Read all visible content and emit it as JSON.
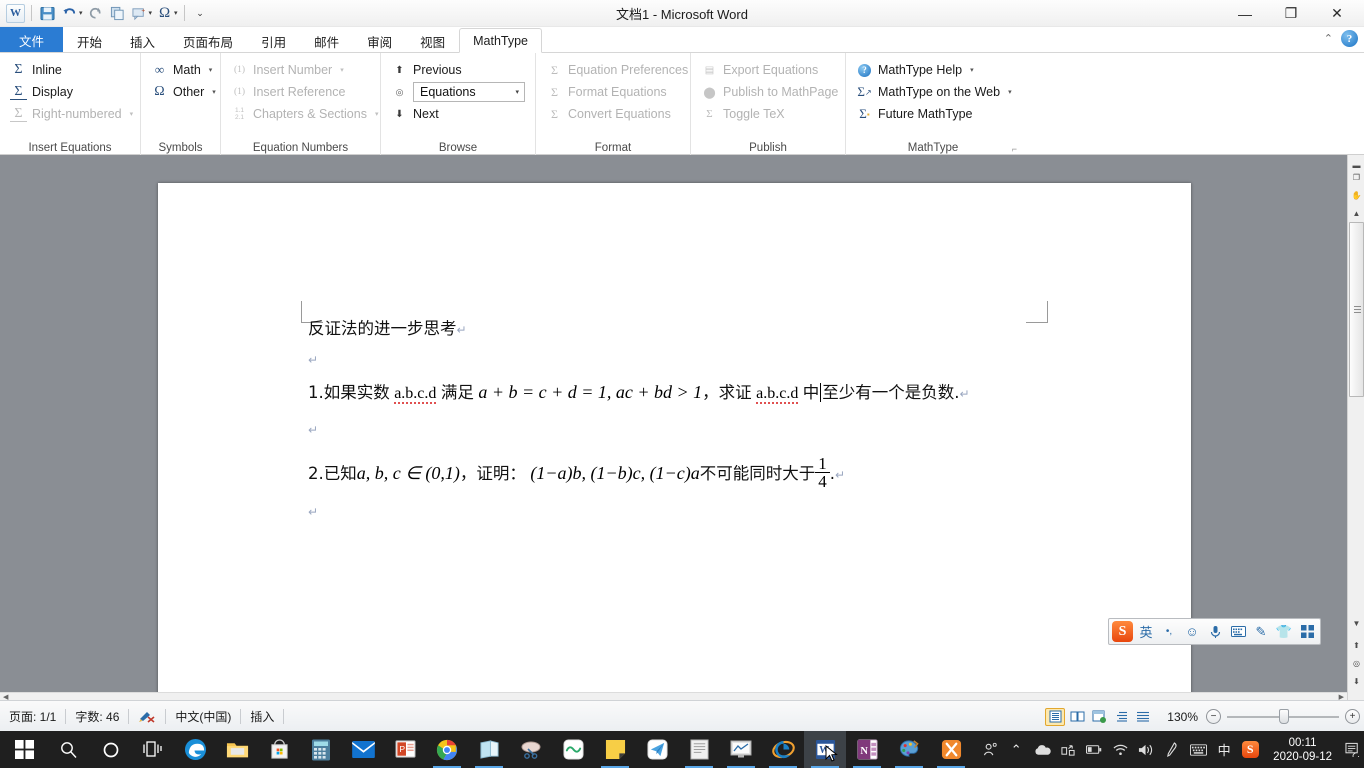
{
  "window": {
    "title": "文档1  -  Microsoft Word",
    "minimize": "—",
    "restore": "❐",
    "close": "✕"
  },
  "quick_access": {
    "app_logo": "W",
    "items": [
      {
        "name": "save",
        "glyph": "💾"
      },
      {
        "name": "undo",
        "glyph": "↶"
      },
      {
        "name": "redo",
        "glyph": "↺"
      },
      {
        "name": "copy",
        "glyph": "❐"
      },
      {
        "name": "new-comment",
        "glyph": "▦"
      },
      {
        "name": "symbol",
        "glyph": "Ω"
      },
      {
        "name": "customize",
        "glyph": "⌄"
      }
    ]
  },
  "tabs": [
    {
      "label": "文件",
      "type": "file"
    },
    {
      "label": "开始",
      "type": "normal"
    },
    {
      "label": "插入",
      "type": "normal"
    },
    {
      "label": "页面布局",
      "type": "normal"
    },
    {
      "label": "引用",
      "type": "normal"
    },
    {
      "label": "邮件",
      "type": "normal"
    },
    {
      "label": "审阅",
      "type": "normal"
    },
    {
      "label": "视图",
      "type": "normal"
    },
    {
      "label": "MathType",
      "type": "active"
    }
  ],
  "ribbon": {
    "groups": [
      {
        "title": "Insert Equations",
        "items": [
          {
            "label": "Inline",
            "icon": "sigma-icon",
            "disabled": false,
            "dropdown": false
          },
          {
            "label": "Display",
            "icon": "sigma-underline-icon",
            "disabled": false,
            "dropdown": false
          },
          {
            "label": "Right-numbered",
            "icon": "sigma-numbered-icon",
            "disabled": true,
            "dropdown": true
          }
        ]
      },
      {
        "title": "Symbols",
        "items": [
          {
            "label": "Math",
            "icon": "infinity-icon",
            "disabled": false,
            "dropdown": true
          },
          {
            "label": "Other",
            "icon": "omega-icon",
            "disabled": false,
            "dropdown": true
          }
        ]
      },
      {
        "title": "Equation Numbers",
        "items": [
          {
            "label": "Insert Number",
            "icon": "number-paren-icon",
            "disabled": true,
            "dropdown": true
          },
          {
            "label": "Insert Reference",
            "icon": "reference-icon",
            "disabled": true,
            "dropdown": false
          },
          {
            "label": "Chapters & Sections",
            "icon": "chapters-icon",
            "disabled": true,
            "dropdown": true
          }
        ]
      },
      {
        "title": "Browse",
        "items": [
          {
            "label": "Previous",
            "icon": "arrow-up-bar-icon",
            "disabled": false,
            "dropdown": false
          },
          {
            "label": "Equations",
            "icon": "browse-target-icon",
            "disabled": false,
            "dropdown": false,
            "is_combo": true
          },
          {
            "label": "Next",
            "icon": "arrow-down-bar-icon",
            "disabled": false,
            "dropdown": false
          }
        ]
      },
      {
        "title": "Format",
        "items": [
          {
            "label": "Equation Preferences",
            "icon": "preferences-icon",
            "disabled": true,
            "dropdown": false
          },
          {
            "label": "Format Equations",
            "icon": "format-icon",
            "disabled": true,
            "dropdown": false
          },
          {
            "label": "Convert Equations",
            "icon": "convert-icon",
            "disabled": true,
            "dropdown": false
          }
        ]
      },
      {
        "title": "Publish",
        "items": [
          {
            "label": "Export Equations",
            "icon": "export-icon",
            "disabled": true,
            "dropdown": false
          },
          {
            "label": "Publish to MathPage",
            "icon": "mathpage-icon",
            "disabled": true,
            "dropdown": false
          },
          {
            "label": "Toggle TeX",
            "icon": "tex-icon",
            "disabled": true,
            "dropdown": false
          }
        ]
      },
      {
        "title": "MathType",
        "items": [
          {
            "label": "MathType Help",
            "icon": "help-circle-icon",
            "disabled": false,
            "dropdown": true
          },
          {
            "label": "MathType on the Web",
            "icon": "sigma-web-icon",
            "disabled": false,
            "dropdown": true
          },
          {
            "label": "Future MathType",
            "icon": "sigma-future-icon",
            "disabled": false,
            "dropdown": false
          }
        ],
        "has_dialog_launcher": true
      }
    ],
    "combo_value": "Equations"
  },
  "document": {
    "lines": [
      {
        "id": "heading",
        "parts": [
          {
            "t": "cn",
            "v": "反证法的进一步思考"
          },
          {
            "t": "pilcrow",
            "v": "↵"
          }
        ]
      },
      {
        "id": "blank-1",
        "parts": [
          {
            "t": "pilcrow",
            "v": "↵"
          }
        ]
      },
      {
        "id": "problem-1",
        "parts": [
          {
            "t": "cn",
            "v": "1.如果实数 "
          },
          {
            "t": "spell",
            "v": "a.b.c.d"
          },
          {
            "t": "cn",
            "v": " 满足 "
          },
          {
            "t": "math",
            "v": "a + b = c + d = 1, ac + bd > 1"
          },
          {
            "t": "cn",
            "v": "，求证 "
          },
          {
            "t": "spell",
            "v": "a.b.c.d"
          },
          {
            "t": "cn",
            "v": " 中"
          },
          {
            "t": "caret",
            "v": ""
          },
          {
            "t": "cn",
            "v": "至少有一个是负数."
          },
          {
            "t": "pilcrow",
            "v": "↵"
          }
        ]
      },
      {
        "id": "blank-2",
        "parts": [
          {
            "t": "pilcrow",
            "v": "↵"
          }
        ]
      },
      {
        "id": "problem-2",
        "parts": [
          {
            "t": "cn",
            "v": "2.已知"
          },
          {
            "t": "math",
            "v": "a, b, c ∈ (0,1)"
          },
          {
            "t": "cn",
            "v": "，证明："
          },
          {
            "t": "math",
            "v": "(1−a)b, (1−b)c, (1−c)a"
          },
          {
            "t": "cn",
            "v": "不可能同时大于"
          },
          {
            "t": "frac",
            "num": "1",
            "den": "4"
          },
          {
            "t": "cn",
            "v": "."
          },
          {
            "t": "pilcrow",
            "v": "↵"
          }
        ]
      },
      {
        "id": "blank-3",
        "parts": [
          {
            "t": "pilcrow",
            "v": "↵"
          }
        ]
      }
    ],
    "heading_text": "反证法的进一步思考",
    "p1_prefix": "1.如果实数",
    "p1_vars_1": "a.b.c.d",
    "p1_mid": "满足",
    "p1_eq": "a + b = c + d = 1, ac + bd > 1",
    "p1_comma": "，求证",
    "p1_vars_2": "a.b.c.d",
    "p1_zhong": "中",
    "p1_tail": "至少有一个是负数.",
    "p2_prefix": "2.已知",
    "p2_set": "a, b, c ∈ (0,1)",
    "p2_mid": "，证明：",
    "p2_expr": "(1−a)b, (1−b)c, (1−c)a",
    "p2_tail": "不可能同时大于",
    "p2_frac_num": "1",
    "p2_frac_den": "4",
    "p2_period": "."
  },
  "ime_bar": {
    "logo": "S",
    "buttons": [
      {
        "name": "lang-mode",
        "glyph": "英"
      },
      {
        "name": "punctuation-mode",
        "glyph": "•,"
      },
      {
        "name": "emoji",
        "glyph": "☺"
      },
      {
        "name": "voice-input",
        "glyph": "🎤"
      },
      {
        "name": "soft-keyboard",
        "glyph": "⌨"
      },
      {
        "name": "handwriting",
        "glyph": "✎"
      },
      {
        "name": "skin",
        "glyph": "👕"
      },
      {
        "name": "toolbox",
        "glyph": "▩"
      }
    ]
  },
  "status_bar": {
    "page": "页面: 1/1",
    "words": "字数: 46",
    "proofing_icon": "spellcheck-icon",
    "language": "中文(中国)",
    "insert_mode": "插入",
    "zoom": "130%",
    "view_buttons": [
      {
        "name": "print-layout-view",
        "glyph": "▤",
        "selected": true
      },
      {
        "name": "full-screen-reading-view",
        "glyph": "▥",
        "selected": false
      },
      {
        "name": "web-layout-view",
        "glyph": "▣",
        "selected": false
      },
      {
        "name": "outline-view",
        "glyph": "☰",
        "selected": false
      },
      {
        "name": "draft-view",
        "glyph": "≡",
        "selected": false
      }
    ],
    "zoom_out": "−",
    "zoom_in": "+"
  },
  "taskbar": {
    "left_items": [
      {
        "name": "start-button",
        "glyph": "⊞",
        "color": "#ffffff",
        "bg": "transparent",
        "running": false
      },
      {
        "name": "search-button",
        "glyph": "⌕",
        "color": "#ffffff",
        "bg": "transparent",
        "running": false
      },
      {
        "name": "cortana-button",
        "glyph": "◯",
        "color": "#ffffff",
        "bg": "transparent",
        "running": false
      },
      {
        "name": "task-view-button",
        "glyph": "⧉",
        "color": "#ffffff",
        "bg": "transparent",
        "running": false
      },
      {
        "name": "edge-icon",
        "glyph": "e",
        "color": "#ffffff",
        "bg": "#1a8fd8",
        "running": false
      },
      {
        "name": "file-explorer-icon",
        "glyph": "🗀",
        "color": "#ffc83d",
        "bg": "transparent",
        "running": false
      },
      {
        "name": "microsoft-store-icon",
        "glyph": "🛍",
        "color": "#ffffff",
        "bg": "#f4f4f4",
        "running": false
      },
      {
        "name": "calculator-icon",
        "glyph": "▦",
        "color": "#3b82b8",
        "bg": "#d8e8f2",
        "running": false
      },
      {
        "name": "mail-icon",
        "glyph": "✉",
        "color": "#ffffff",
        "bg": "#0f6fc6",
        "running": false
      },
      {
        "name": "powerpoint-icon",
        "glyph": "P",
        "color": "#ffffff",
        "bg": "#d24726",
        "running": false
      },
      {
        "name": "chrome-icon",
        "glyph": "◉",
        "color": "#ffffff",
        "bg": "transparent",
        "running": true
      },
      {
        "name": "onenote-book-icon",
        "glyph": "📘",
        "color": "#ffffff",
        "bg": "transparent",
        "running": true
      },
      {
        "name": "snipaste-icon",
        "glyph": "✄",
        "color": "#ffffff",
        "bg": "transparent",
        "running": false
      },
      {
        "name": "youdao-cloud-icon",
        "glyph": "∾",
        "color": "#2aa96a",
        "bg": "#ffffff",
        "running": false
      },
      {
        "name": "sticky-notes-icon",
        "glyph": "▰",
        "color": "#3b3b3b",
        "bg": "#f5c518",
        "running": true
      },
      {
        "name": "telegram-icon",
        "glyph": "✈",
        "color": "#4aa3e0",
        "bg": "#ffffff",
        "running": false
      },
      {
        "name": "notepad-icon",
        "glyph": "▤",
        "color": "#888888",
        "bg": "#e8e8e8",
        "running": true
      },
      {
        "name": "stock-app-icon",
        "glyph": "📈",
        "color": "#ffffff",
        "bg": "#dcdcdc",
        "running": true
      },
      {
        "name": "internet-explorer-icon",
        "glyph": "e",
        "color": "#1a8fd8",
        "bg": "transparent",
        "running": true
      },
      {
        "name": "word-icon",
        "glyph": "W",
        "color": "#ffffff",
        "bg": "#2b579a",
        "running": true,
        "active": true
      },
      {
        "name": "onenote-icon",
        "glyph": "N",
        "color": "#ffffff",
        "bg": "#80397b",
        "running": true
      },
      {
        "name": "paint-icon",
        "glyph": "🎨",
        "color": "#ffffff",
        "bg": "transparent",
        "running": true
      },
      {
        "name": "xmind-icon",
        "glyph": "✂",
        "color": "#ffffff",
        "bg": "#f0882c",
        "running": true
      }
    ],
    "tray": [
      {
        "name": "people-icon",
        "glyph": "⚇"
      },
      {
        "name": "show-hidden-icons-chevron",
        "glyph": "⌃"
      },
      {
        "name": "onedrive-icon",
        "glyph": "☁"
      },
      {
        "name": "network-adapter-icon",
        "glyph": "⛁"
      },
      {
        "name": "battery-icon",
        "glyph": "▭"
      },
      {
        "name": "wifi-icon",
        "glyph": "◗"
      },
      {
        "name": "volume-icon",
        "glyph": "🔊"
      },
      {
        "name": "pen-icon",
        "glyph": "✒"
      },
      {
        "name": "touch-keyboard-icon",
        "glyph": "⌨"
      },
      {
        "name": "ime-mode-icon",
        "glyph": "中"
      },
      {
        "name": "sogou-tray-icon",
        "glyph": "S"
      }
    ],
    "clock_time": "00:11",
    "clock_date": "2020-09-12",
    "action_center_icon": "notifications-icon"
  }
}
